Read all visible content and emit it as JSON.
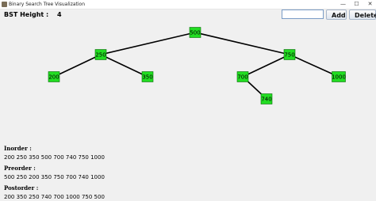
{
  "window": {
    "title": "Binary Search Tree Visualization",
    "minimize_glyph": "—",
    "maximize_glyph": "☐",
    "close_glyph": "✕"
  },
  "toolbar": {
    "height_label": "BST Height :",
    "height_value": "4",
    "input_value": "",
    "input_placeholder": "",
    "add_label": "Add",
    "delete_label": "Delete"
  },
  "tree": {
    "node_color": "#22dd22",
    "edge_color": "#000000",
    "nodes": [
      {
        "id": "500",
        "label": "500"
      },
      {
        "id": "250",
        "label": "250"
      },
      {
        "id": "750",
        "label": "750"
      },
      {
        "id": "200",
        "label": "200"
      },
      {
        "id": "350",
        "label": "350"
      },
      {
        "id": "700",
        "label": "700"
      },
      {
        "id": "1000",
        "label": "1000"
      },
      {
        "id": "740",
        "label": "740"
      }
    ],
    "edges": [
      [
        "500",
        "250"
      ],
      [
        "500",
        "750"
      ],
      [
        "250",
        "200"
      ],
      [
        "250",
        "350"
      ],
      [
        "750",
        "700"
      ],
      [
        "750",
        "1000"
      ],
      [
        "700",
        "740"
      ]
    ]
  },
  "traversals": {
    "inorder": {
      "title": "Inorder :",
      "values": "200 250 350 500 700 740 750 1000"
    },
    "preorder": {
      "title": "Preorder :",
      "values": "500 250 200 350 750 700 740 1000"
    },
    "postorder": {
      "title": "Postorder :",
      "values": "200 350 250 740 700 1000 750 500"
    }
  }
}
